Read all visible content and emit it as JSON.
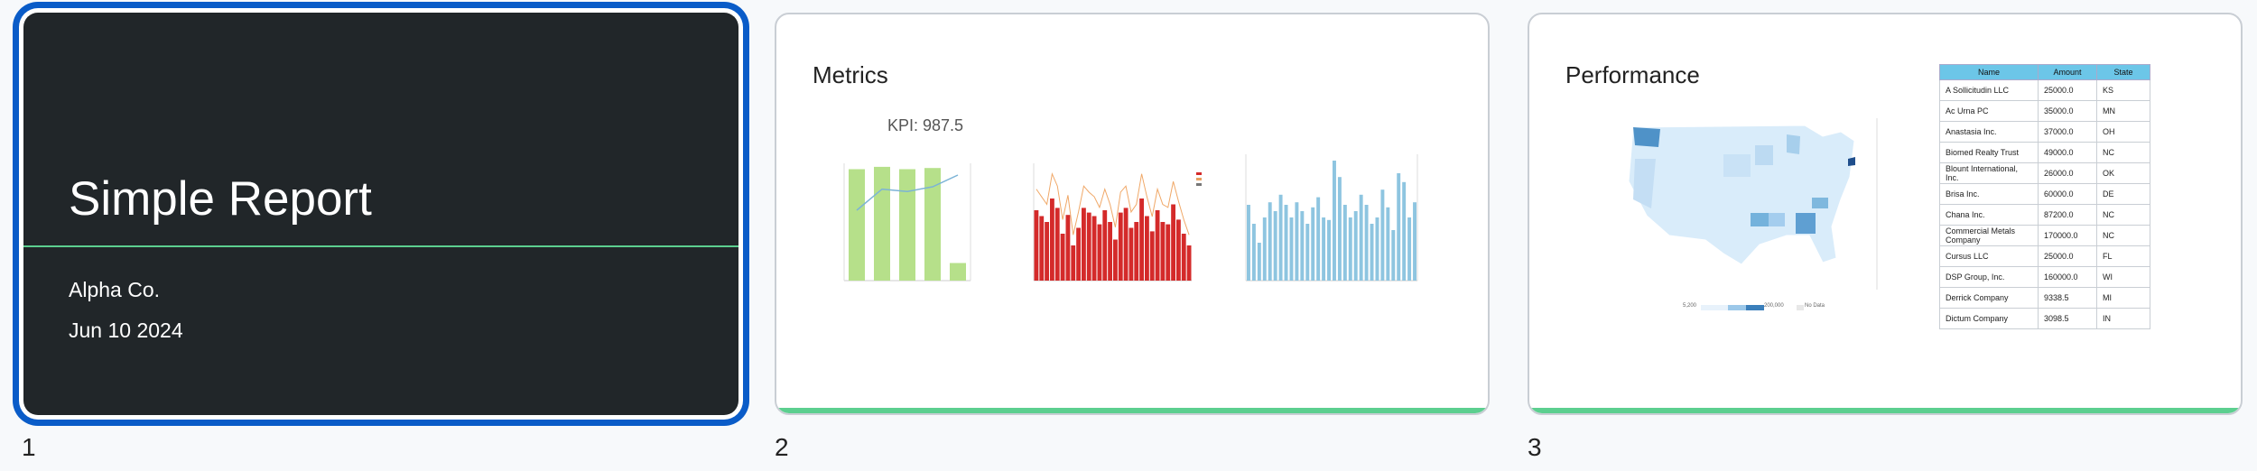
{
  "slides": [
    {
      "number": "1",
      "title": "Simple Report",
      "company": "Alpha Co.",
      "date": "Jun 10 2024"
    },
    {
      "number": "2",
      "title": "Metrics",
      "kpi": "KPI: 987.5"
    },
    {
      "number": "3",
      "title": "Performance",
      "map_legend": {
        "min": "5,200",
        "max": "200,000",
        "no_data": "No Data"
      },
      "table": {
        "headers": [
          "Name",
          "Amount",
          "State"
        ],
        "rows": [
          [
            "A Sollicitudin LLC",
            "25000.0",
            "KS"
          ],
          [
            "Ac Urna PC",
            "35000.0",
            "MN"
          ],
          [
            "Anastasia Inc.",
            "37000.0",
            "OH"
          ],
          [
            "Biomed Realty Trust",
            "49000.0",
            "NC"
          ],
          [
            "Blount International, Inc.",
            "26000.0",
            "OK"
          ],
          [
            "Brisa Inc.",
            "60000.0",
            "DE"
          ],
          [
            "Chana Inc.",
            "87200.0",
            "NC"
          ],
          [
            "Commercial Metals Company",
            "170000.0",
            "NC"
          ],
          [
            "Cursus LLC",
            "25000.0",
            "FL"
          ],
          [
            "DSP Group, Inc.",
            "160000.0",
            "WI"
          ],
          [
            "Derrick Company",
            "9338.5",
            "MI"
          ],
          [
            "Dictum Company",
            "3098.5",
            "IN"
          ]
        ]
      }
    }
  ],
  "colors": {
    "accent_green": "#5ccf8f",
    "selection_blue": "#0a5cc8",
    "dark_slide": "#212629"
  },
  "chart_data": [
    {
      "type": "bar",
      "description": "combo bar + line",
      "values": [
        0.95,
        0.97,
        0.95,
        0.96,
        0.15
      ],
      "line": [
        0.6,
        0.78,
        0.76,
        0.8,
        0.9
      ],
      "bar_color": "#b6e08a",
      "line_color": "#7bb3d6"
    },
    {
      "type": "bar",
      "bar_color": "#d42a2a",
      "values": [
        0.6,
        0.55,
        0.5,
        0.7,
        0.62,
        0.4,
        0.56,
        0.3,
        0.45,
        0.62,
        0.58,
        0.55,
        0.48,
        0.6,
        0.5,
        0.35,
        0.58,
        0.62,
        0.45,
        0.5,
        0.7,
        0.55,
        0.42,
        0.6,
        0.5,
        0.48,
        0.65,
        0.52,
        0.4,
        0.3
      ]
    },
    {
      "type": "bar",
      "bar_color": "#8ec5e0",
      "values": [
        0.6,
        0.45,
        0.3,
        0.5,
        0.62,
        0.55,
        0.68,
        0.6,
        0.5,
        0.62,
        0.55,
        0.45,
        0.58,
        0.66,
        0.5,
        0.48,
        0.95,
        0.82,
        0.6,
        0.5,
        0.55,
        0.68,
        0.6,
        0.45,
        0.5,
        0.72,
        0.58,
        0.4,
        0.85,
        0.78,
        0.5,
        0.62
      ]
    }
  ]
}
